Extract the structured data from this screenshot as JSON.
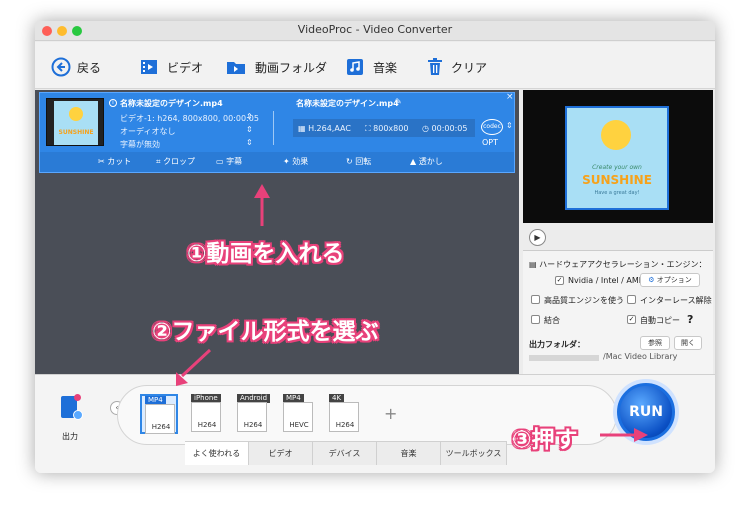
{
  "window": {
    "title": "VideoProc - Video Converter"
  },
  "toolbar": {
    "back": "戻る",
    "video": "ビデオ",
    "video_folder": "動画フォルダ",
    "music": "音楽",
    "clear": "クリア"
  },
  "item": {
    "source_name": "名称未設定のデザイン.mp4",
    "video_info": "ビデオ-1: h264, 800x800, 00:00:05",
    "audio_info": "オーディオなし",
    "subtitle_info": "字幕が無効",
    "output_name": "名称未設定のデザイン.mp4",
    "codec": "H.264,AAC",
    "resolution": "800x800",
    "duration": "00:00:05",
    "codec_badge": "codec",
    "opt": "OPT"
  },
  "thumbnail": {
    "line1": "Create your own",
    "line2": "SUNSHINE",
    "line3": "Have a great day!"
  },
  "edit_bar": [
    "カット",
    "クロップ",
    "字幕",
    "効果",
    "回転",
    "透かし"
  ],
  "settings": {
    "hw_accel": "ハードウェアアクセラレーション・エンジン：",
    "gpu": "Nvidia / Intel / AMD",
    "option": "オプション",
    "high_quality": "高品質エンジンを使う",
    "deinterlace": "インターレース解除",
    "merge": "結合",
    "auto_copy": "自動コピー",
    "help": "?",
    "output_folder": "出力フォルダ：",
    "browse": "参照",
    "open": "開く",
    "folder_path": "/Mac Video Library"
  },
  "output_label": "出力",
  "formats": [
    {
      "hdr": "MP4",
      "sub": "H264"
    },
    {
      "hdr": "iPhone",
      "sub": "H264"
    },
    {
      "hdr": "Android",
      "sub": "H264"
    },
    {
      "hdr": "MP4",
      "sub": "HEVC"
    },
    {
      "hdr": "4K",
      "sub": "H264"
    }
  ],
  "tabs": [
    "よく使われる",
    "ビデオ",
    "デバイス",
    "音楽",
    "ツールボックス"
  ],
  "run": "RUN",
  "annotations": {
    "step1": "①動画を入れる",
    "step2": "②ファイル形式を選ぶ",
    "step3": "③押す"
  },
  "colors": {
    "accent": "#2f86e6",
    "annotation": "#e8417a",
    "run": "#0a4fc4"
  }
}
